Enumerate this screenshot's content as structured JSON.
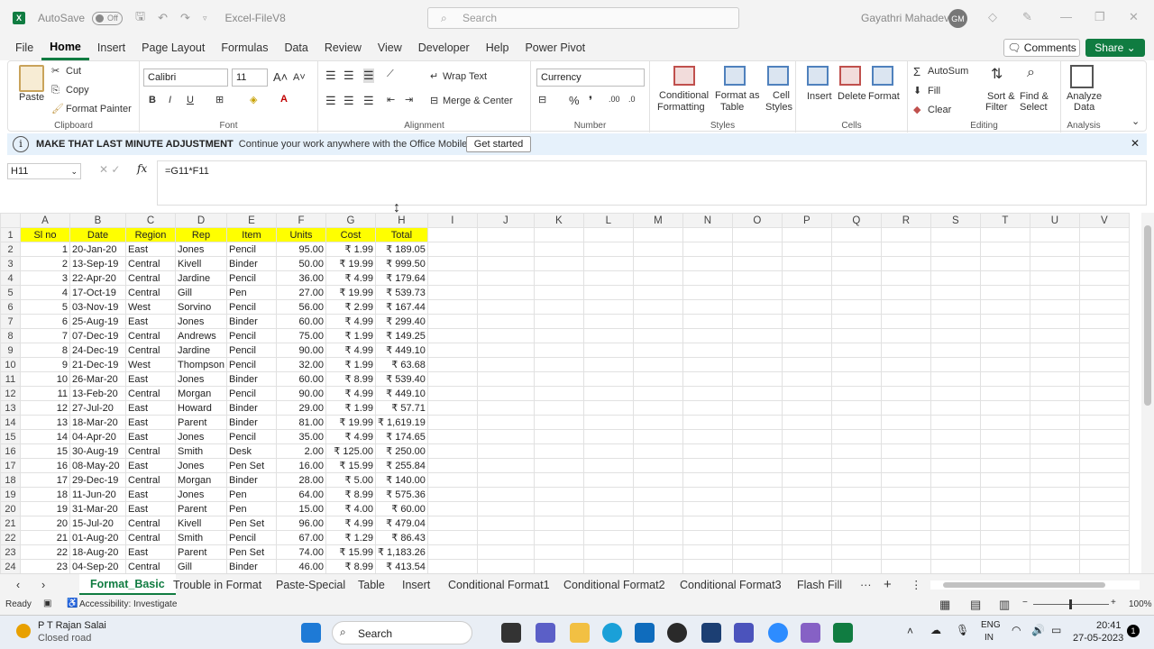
{
  "titlebar": {
    "autosave_label": "AutoSave",
    "autosave_state": "Off",
    "filename": "Excel-FileV8",
    "search_placeholder": "Search",
    "user_name": "Gayathri Mahadevan",
    "user_initials": "GM"
  },
  "menu": [
    "File",
    "Home",
    "Insert",
    "Page Layout",
    "Formulas",
    "Data",
    "Review",
    "View",
    "Developer",
    "Help",
    "Power Pivot"
  ],
  "menu_active": "Home",
  "buttons": {
    "comments": "Comments",
    "share": "Share"
  },
  "ribbon": {
    "clipboard": {
      "paste": "Paste",
      "cut": "Cut",
      "copy": "Copy",
      "format_painter": "Format Painter",
      "label": "Clipboard"
    },
    "font": {
      "name": "Calibri",
      "size": "11",
      "label": "Font",
      "bold": "B",
      "italic": "I",
      "underline": "U"
    },
    "alignment": {
      "wrap": "Wrap Text",
      "merge": "Merge & Center",
      "label": "Alignment"
    },
    "number": {
      "format": "Currency",
      "label": "Number"
    },
    "styles": {
      "conditional": "Conditional",
      "formatting": "Formatting",
      "format_as": "Format as",
      "table": "Table",
      "cell": "Cell",
      "cell_styles": "Styles",
      "label": "Styles"
    },
    "cells": {
      "insert": "Insert",
      "delete": "Delete",
      "format": "Format",
      "label": "Cells"
    },
    "editing": {
      "autosum": "AutoSum",
      "fill": "Fill",
      "clear": "Clear",
      "sort": "Sort &",
      "filter": "Filter",
      "find": "Find &",
      "select": "Select",
      "label": "Editing"
    },
    "analysis": {
      "analyze": "Analyze",
      "data": "Data",
      "label": "Analysis"
    }
  },
  "infobar": {
    "title": "MAKE THAT LAST MINUTE ADJUSTMENT",
    "message": "Continue your work anywhere with the Office Mobile App",
    "button": "Get started"
  },
  "formula_bar": {
    "name_box": "H11",
    "fx": "fx",
    "formula": "=G11*F11"
  },
  "columns": [
    "A",
    "B",
    "C",
    "D",
    "E",
    "F",
    "G",
    "H",
    "I",
    "J",
    "K",
    "L",
    "M",
    "N",
    "O",
    "P",
    "Q",
    "R",
    "S",
    "T",
    "U",
    "V"
  ],
  "header_row": [
    "Sl no",
    "Date",
    "Region",
    "Rep",
    "Item",
    "Units",
    "Cost",
    "Total"
  ],
  "rows": [
    [
      "1",
      "20-Jan-20",
      "East",
      "Jones",
      "Pencil",
      "95.00",
      "₹ 1.99",
      "₹ 189.05"
    ],
    [
      "2",
      "13-Sep-19",
      "Central",
      "Kivell",
      "Binder",
      "50.00",
      "₹ 19.99",
      "₹ 999.50"
    ],
    [
      "3",
      "22-Apr-20",
      "Central",
      "Jardine",
      "Pencil",
      "36.00",
      "₹ 4.99",
      "₹ 179.64"
    ],
    [
      "4",
      "17-Oct-19",
      "Central",
      "Gill",
      "Pen",
      "27.00",
      "₹ 19.99",
      "₹ 539.73"
    ],
    [
      "5",
      "03-Nov-19",
      "West",
      "Sorvino",
      "Pencil",
      "56.00",
      "₹ 2.99",
      "₹ 167.44"
    ],
    [
      "6",
      "25-Aug-19",
      "East",
      "Jones",
      "Binder",
      "60.00",
      "₹ 4.99",
      "₹ 299.40"
    ],
    [
      "7",
      "07-Dec-19",
      "Central",
      "Andrews",
      "Pencil",
      "75.00",
      "₹ 1.99",
      "₹ 149.25"
    ],
    [
      "8",
      "24-Dec-19",
      "Central",
      "Jardine",
      "Pencil",
      "90.00",
      "₹ 4.99",
      "₹ 449.10"
    ],
    [
      "9",
      "21-Dec-19",
      "West",
      "Thompson",
      "Pencil",
      "32.00",
      "₹ 1.99",
      "₹ 63.68"
    ],
    [
      "10",
      "26-Mar-20",
      "East",
      "Jones",
      "Binder",
      "60.00",
      "₹ 8.99",
      "₹ 539.40"
    ],
    [
      "11",
      "13-Feb-20",
      "Central",
      "Morgan",
      "Pencil",
      "90.00",
      "₹ 4.99",
      "₹ 449.10"
    ],
    [
      "12",
      "27-Jul-20",
      "East",
      "Howard",
      "Binder",
      "29.00",
      "₹ 1.99",
      "₹ 57.71"
    ],
    [
      "13",
      "18-Mar-20",
      "East",
      "Parent",
      "Binder",
      "81.00",
      "₹ 19.99",
      "₹ 1,619.19"
    ],
    [
      "14",
      "04-Apr-20",
      "East",
      "Jones",
      "Pencil",
      "35.00",
      "₹ 4.99",
      "₹ 174.65"
    ],
    [
      "15",
      "30-Aug-19",
      "Central",
      "Smith",
      "Desk",
      "2.00",
      "₹ 125.00",
      "₹ 250.00"
    ],
    [
      "16",
      "08-May-20",
      "East",
      "Jones",
      "Pen Set",
      "16.00",
      "₹ 15.99",
      "₹ 255.84"
    ],
    [
      "17",
      "29-Dec-19",
      "Central",
      "Morgan",
      "Binder",
      "28.00",
      "₹ 5.00",
      "₹ 140.00"
    ],
    [
      "18",
      "11-Jun-20",
      "East",
      "Jones",
      "Pen",
      "64.00",
      "₹ 8.99",
      "₹ 575.36"
    ],
    [
      "19",
      "31-Mar-20",
      "East",
      "Parent",
      "Pen",
      "15.00",
      "₹ 4.00",
      "₹ 60.00"
    ],
    [
      "20",
      "15-Jul-20",
      "Central",
      "Kivell",
      "Pen Set",
      "96.00",
      "₹ 4.99",
      "₹ 479.04"
    ],
    [
      "21",
      "01-Aug-20",
      "Central",
      "Smith",
      "Pencil",
      "67.00",
      "₹ 1.29",
      "₹ 86.43"
    ],
    [
      "22",
      "18-Aug-20",
      "East",
      "Parent",
      "Pen Set",
      "74.00",
      "₹ 15.99",
      "₹ 1,183.26"
    ],
    [
      "23",
      "04-Sep-20",
      "Central",
      "Gill",
      "Binder",
      "46.00",
      "₹ 8.99",
      "₹ 413.54"
    ]
  ],
  "sheet_tabs": [
    "Format_Basic",
    "Trouble in Format",
    "Paste-Special",
    "Table",
    "Insert",
    "Conditional Format1",
    "Conditional Format2",
    "Conditional Format3",
    "Flash Fill"
  ],
  "active_tab": "Format_Basic",
  "status": {
    "ready": "Ready",
    "accessibility": "Accessibility: Investigate",
    "zoom": "100%"
  },
  "taskbar": {
    "location_title": "P T Rajan Salai",
    "location_sub": "Closed road",
    "search": "Search",
    "lang1": "ENG",
    "lang2": "IN",
    "time": "20:41",
    "date": "27-05-2023",
    "notif": "1"
  },
  "colors": {
    "excel_green": "#107c41",
    "header_fill": "#ffff00",
    "info_bg": "#e6f1fb"
  }
}
